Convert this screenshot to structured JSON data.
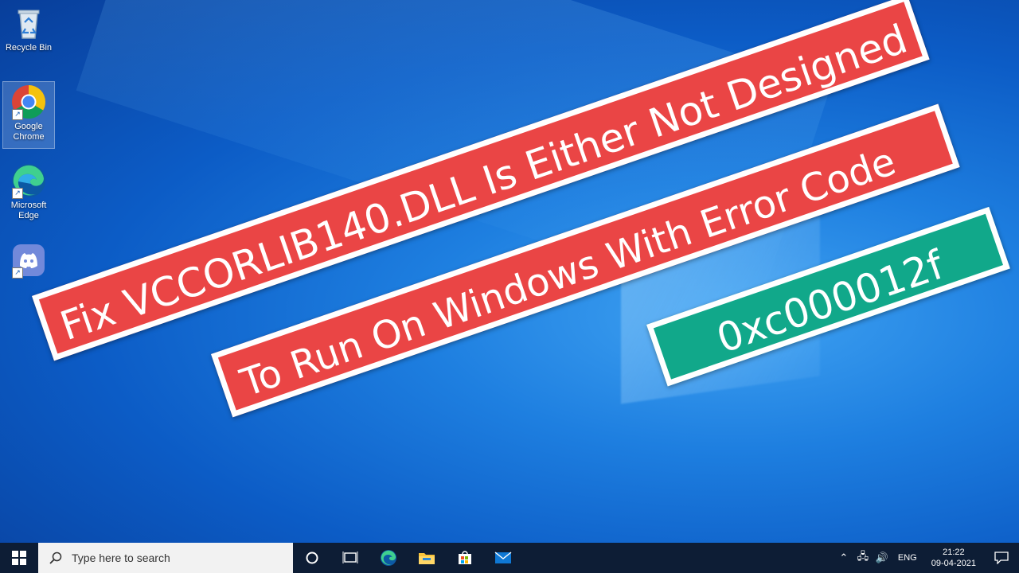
{
  "desktop_icons": [
    {
      "label": "Recycle Bin",
      "icon": "recycle-bin-icon"
    },
    {
      "label": "Google\nChrome",
      "icon": "chrome-icon"
    },
    {
      "label": "Microsoft\nEdge",
      "icon": "edge-icon"
    },
    {
      "label": "",
      "icon": "discord-icon"
    }
  ],
  "banners": {
    "line1": "Fix VCCORLIB140.DLL Is Either Not Designed",
    "line2": "To Run On Windows  With Error Code",
    "code": "0xc000012f"
  },
  "colors": {
    "banner_red": "#ea4545",
    "banner_green": "#11a88a",
    "taskbar": "#0d1d35"
  },
  "taskbar": {
    "search_placeholder": "Type here to search",
    "apps": [
      "cortana-icon",
      "task-view-icon",
      "edge-icon",
      "file-explorer-icon",
      "store-icon",
      "mail-icon"
    ],
    "tray": {
      "language": "ENG",
      "time": "21:22",
      "date": "09-04-2021"
    }
  }
}
